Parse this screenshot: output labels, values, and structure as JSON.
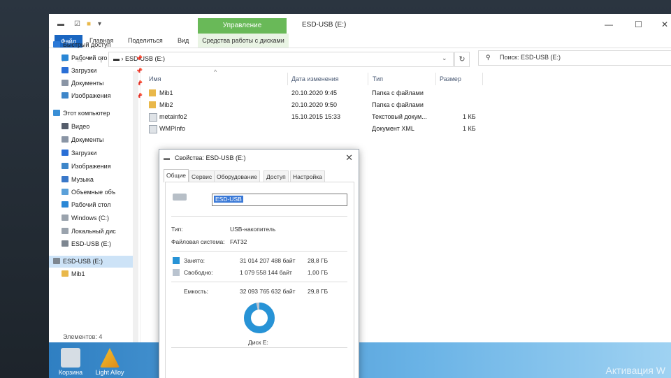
{
  "explorer": {
    "title": "ESD-USB (E:)",
    "manage_tab": "Управление",
    "ribbon": {
      "file": "Файл",
      "tabs": [
        "Главная",
        "Поделиться",
        "Вид"
      ],
      "context_tab": "Средства работы с дисками"
    },
    "address": "ESD-USB (E:)",
    "search_placeholder": "Поиск: ESD-USB (E:)",
    "status": "Элементов: 4"
  },
  "nav_pane": {
    "items": [
      {
        "label": "Быстрый доступ",
        "icon": "star-icon",
        "color": "#2a78d6",
        "pinned": false
      },
      {
        "label": "Рабочий сто",
        "icon": "desktop-icon",
        "color": "#2a87d6",
        "pinned": true
      },
      {
        "label": "Загрузки",
        "icon": "download-icon",
        "color": "#2a6fd6",
        "pinned": true
      },
      {
        "label": "Документы",
        "icon": "documents-icon",
        "color": "#8a95a5",
        "pinned": true
      },
      {
        "label": "Изображения",
        "icon": "pictures-icon",
        "color": "#3e86c9",
        "pinned": true
      },
      {
        "label": "Этот компьютер",
        "icon": "computer-icon",
        "color": "#3a8fd6",
        "pinned": false
      },
      {
        "label": "Видео",
        "icon": "video-icon",
        "color": "#555d6b",
        "pinned": false
      },
      {
        "label": "Документы",
        "icon": "documents-icon",
        "color": "#8a95a5",
        "pinned": false
      },
      {
        "label": "Загрузки",
        "icon": "download-icon",
        "color": "#2a6fd6",
        "pinned": false
      },
      {
        "label": "Изображения",
        "icon": "pictures-icon",
        "color": "#3e86c9",
        "pinned": false
      },
      {
        "label": "Музыка",
        "icon": "music-icon",
        "color": "#3a78c9",
        "pinned": false
      },
      {
        "label": "Объемные объ",
        "icon": "objects-icon",
        "color": "#5ba0d9",
        "pinned": false
      },
      {
        "label": "Рабочий стол",
        "icon": "desktop-icon",
        "color": "#2a87d6",
        "pinned": false
      },
      {
        "label": "Windows (C:)",
        "icon": "drive-icon",
        "color": "#9aa3ad",
        "pinned": false
      },
      {
        "label": "Локальный дис",
        "icon": "drive-icon",
        "color": "#9aa3ad",
        "pinned": false
      },
      {
        "label": "ESD-USB (E:)",
        "icon": "usb-drive-icon",
        "color": "#7d8690",
        "pinned": false
      },
      {
        "label": "ESD-USB (E:)",
        "icon": "usb-drive-icon",
        "color": "#7d8690",
        "pinned": false,
        "selected": true
      },
      {
        "label": "Mib1",
        "icon": "folder-icon",
        "color": "#e9b84a",
        "pinned": false
      }
    ]
  },
  "file_list": {
    "columns": [
      "Имя",
      "Дата изменения",
      "Тип",
      "Размер"
    ],
    "rows": [
      {
        "name": "Mib1",
        "date": "20.10.2020 9:45",
        "type": "Папка с файлами",
        "size": "",
        "icon": "folder-icon"
      },
      {
        "name": "Mib2",
        "date": "20.10.2020 9:50",
        "type": "Папка с файлами",
        "size": "",
        "icon": "folder-icon"
      },
      {
        "name": "metainfo2",
        "date": "15.10.2015 15:33",
        "type": "Текстовый докум...",
        "size": "1 КБ",
        "icon": "text-file-icon"
      },
      {
        "name": "WMPInfo",
        "date": "",
        "type": "Документ XML",
        "size": "1 КБ",
        "icon": "xml-file-icon"
      }
    ]
  },
  "properties_dialog": {
    "title": "Свойства: ESD-USB (E:)",
    "tabs": [
      "Общие",
      "Сервис",
      "Оборудование",
      "Доступ",
      "Настройка"
    ],
    "volume_name": "ESD-USB",
    "type_label": "Тип:",
    "type_value": "USB-накопитель",
    "fs_label": "Файловая система:",
    "fs_value": "FAT32",
    "used_label": "Занято:",
    "used_bytes": "31 014 207 488 байт",
    "used_gb": "28,8 ГБ",
    "free_label": "Свободно:",
    "free_bytes": "1 079 558 144 байт",
    "free_gb": "1,00 ГБ",
    "capacity_label": "Емкость:",
    "capacity_bytes": "32 093 765 632 байт",
    "capacity_gb": "29,8 ГБ",
    "disk_label": "Диск E:",
    "used_fraction": 0.966,
    "used_color": "#2793d6",
    "free_color": "#b9c3cf"
  },
  "desktop": {
    "icons": [
      {
        "label": "Корзина",
        "icon": "recycle-bin-icon"
      },
      {
        "label": "Light Alloy",
        "icon": "light-alloy-icon"
      }
    ],
    "activation": "Активация W"
  }
}
